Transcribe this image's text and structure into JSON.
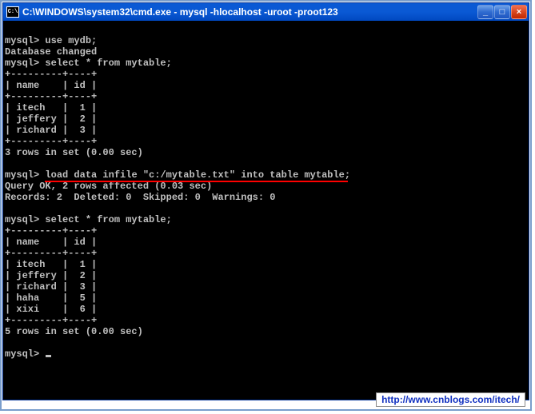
{
  "titlebar": {
    "icon_label": "C:\\",
    "title": "C:\\WINDOWS\\system32\\cmd.exe - mysql  -hlocalhost -uroot -proot123",
    "min_glyph": "_",
    "max_glyph": "□",
    "close_glyph": "×"
  },
  "console": {
    "lines1": [
      "",
      "mysql> use mydb;",
      "Database changed",
      "mysql> select * from mytable;",
      "+---------+----+",
      "| name    | id |",
      "+---------+----+",
      "| itech   |  1 |",
      "| jeffery |  2 |",
      "| richard |  3 |",
      "+---------+----+",
      "3 rows in set (0.00 sec)",
      ""
    ],
    "load_prefix": "mysql> ",
    "load_underlined": "load data infile \"c:/mytable.txt\" into table mytable",
    "load_suffix": ";",
    "lines2": [
      "Query OK, 2 rows affected (0.03 sec)",
      "Records: 2  Deleted: 0  Skipped: 0  Warnings: 0",
      "",
      "mysql> select * from mytable;",
      "+---------+----+",
      "| name    | id |",
      "+---------+----+",
      "| itech   |  1 |",
      "| jeffery |  2 |",
      "| richard |  3 |",
      "| haha    |  5 |",
      "| xixi    |  6 |",
      "+---------+----+",
      "5 rows in set (0.00 sec)",
      ""
    ],
    "prompt": "mysql> "
  },
  "watermark": {
    "url": "http://www.cnblogs.com/itech/"
  },
  "chart_data": {
    "type": "table",
    "before": {
      "columns": [
        "name",
        "id"
      ],
      "rows": [
        [
          "itech",
          1
        ],
        [
          "jeffery",
          2
        ],
        [
          "richard",
          3
        ]
      ],
      "row_count": 3,
      "time_sec": 0.0
    },
    "load_command": "load data infile \"c:/mytable.txt\" into table mytable;",
    "load_result": {
      "rows_affected": 2,
      "time_sec": 0.03,
      "records": 2,
      "deleted": 0,
      "skipped": 0,
      "warnings": 0
    },
    "after": {
      "columns": [
        "name",
        "id"
      ],
      "rows": [
        [
          "itech",
          1
        ],
        [
          "jeffery",
          2
        ],
        [
          "richard",
          3
        ],
        [
          "haha",
          5
        ],
        [
          "xixi",
          6
        ]
      ],
      "row_count": 5,
      "time_sec": 0.0
    }
  }
}
